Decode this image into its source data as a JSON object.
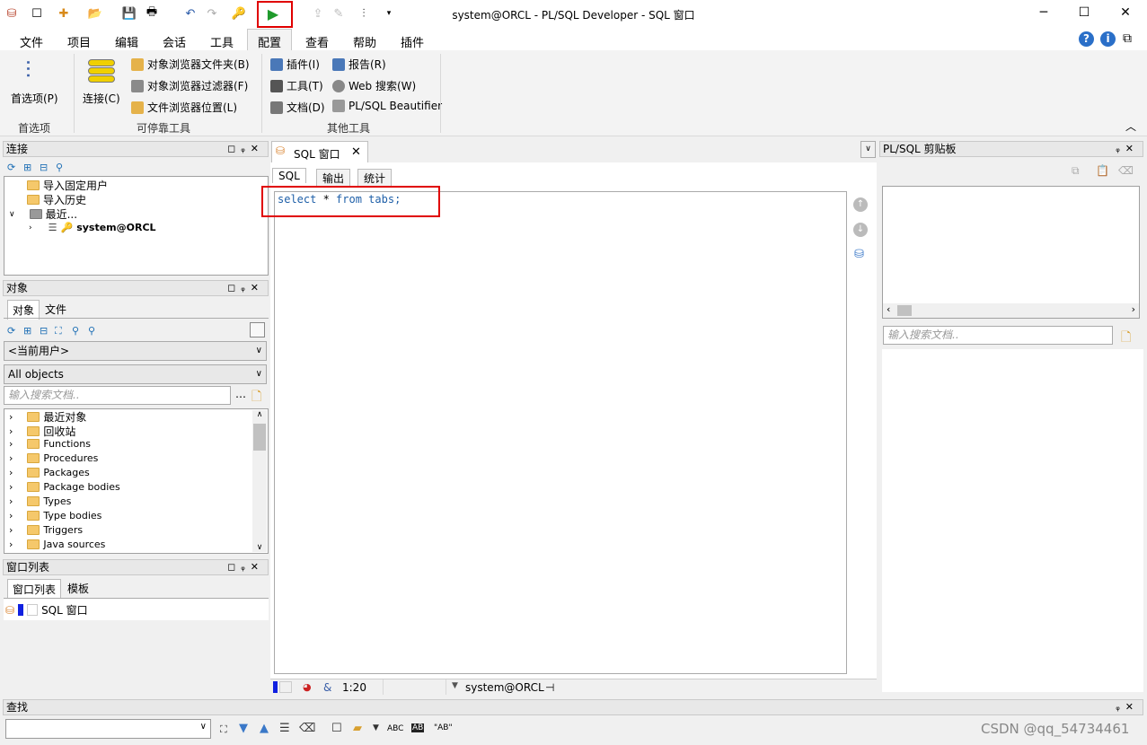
{
  "window": {
    "title": "system@ORCL - PL/SQL Developer - SQL 窗口"
  },
  "menu": [
    "文件",
    "项目",
    "编辑",
    "会话",
    "工具",
    "配置",
    "查看",
    "帮助",
    "插件"
  ],
  "ribbon": {
    "prefs": "首选项(P)",
    "connect": "连接(C)",
    "dock": [
      "对象浏览器文件夹(B)",
      "对象浏览器过滤器(F)",
      "文件浏览器位置(L)"
    ],
    "other_left": [
      "插件(I)",
      "工具(T)",
      "文档(D)"
    ],
    "other_right": [
      "报告(R)",
      "Web 搜索(W)",
      "PL/SQL Beautifier"
    ],
    "groups": [
      "首选项",
      "可停靠工具",
      "其他工具"
    ]
  },
  "connection_panel": {
    "title": "连接",
    "items": [
      "导入固定用户",
      "导入历史",
      "最近...",
      "system@ORCL"
    ]
  },
  "object_panel": {
    "title": "对象",
    "tabs": [
      "对象",
      "文件"
    ],
    "user_combo": "<当前用户>",
    "filter_combo": "All objects",
    "search_placeholder": "输入搜索文档..",
    "items": [
      "最近对象",
      "回收站",
      "Functions",
      "Procedures",
      "Packages",
      "Package bodies",
      "Types",
      "Type bodies",
      "Triggers",
      "Java sources"
    ]
  },
  "window_list": {
    "title": "窗口列表",
    "tabs": [
      "窗口列表",
      "模板"
    ],
    "items": [
      "SQL 窗口"
    ]
  },
  "editor": {
    "doc_tab": "SQL 窗口",
    "tabs": [
      "SQL",
      "输出",
      "统计"
    ],
    "code": {
      "select": "select",
      "rest": " * ",
      "from": "from",
      "table": " tabs;"
    }
  },
  "statusbar": {
    "amp": "&",
    "position": "1:20",
    "connection": "system@ORCL"
  },
  "clipboard": {
    "title": "PL/SQL 剪贴板",
    "search_placeholder": "输入搜索文档.."
  },
  "find": {
    "title": "查找",
    "abc": "ABC",
    "ab": "\"AB\""
  },
  "watermark": "CSDN @qq_54734461"
}
